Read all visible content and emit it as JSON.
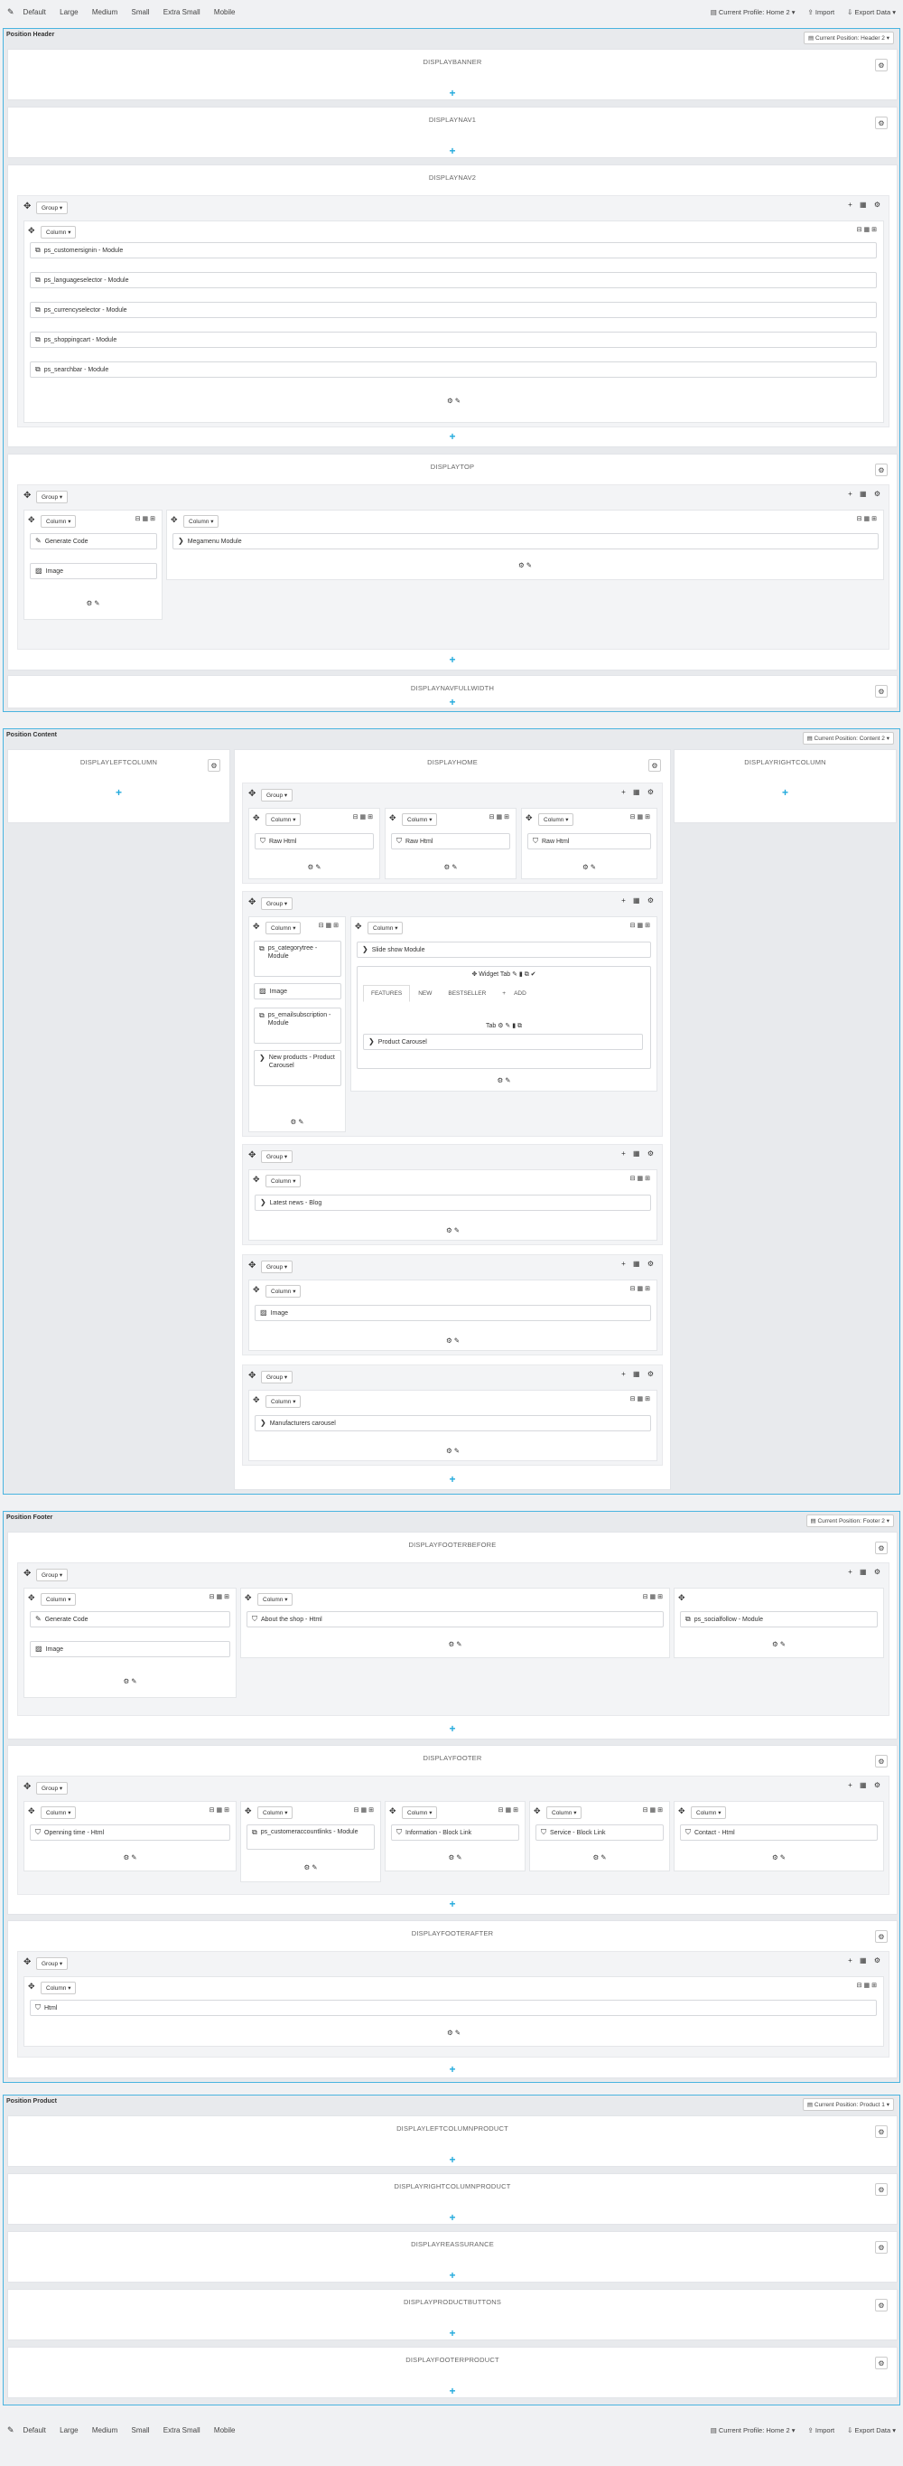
{
  "toolbar": {
    "sizes": [
      "Default",
      "Large",
      "Medium",
      "Small",
      "Extra Small",
      "Mobile"
    ],
    "profile": "Current Profile: Home 2",
    "import": "Import",
    "export": "Export Data"
  },
  "header": {
    "title": "Position Header",
    "position": "Current Position: Header 2",
    "hooks": [
      "DISPLAYBANNER",
      "DISPLAYNAV1",
      "DISPLAYNAV2",
      "DISPLAYTOP",
      "DISPLAYNAVFULLWIDTH"
    ],
    "nav2_modules": [
      "ps_customersignin - Module",
      "ps_languageselector - Module",
      "ps_currencyselector - Module",
      "ps_shoppingcart - Module",
      "ps_searchbar - Module"
    ],
    "top_left_modules": [
      "Generate Code",
      "Image"
    ],
    "top_right_module": "Megamenu Module"
  },
  "content": {
    "title": "Position Content",
    "position": "Current Position: Content 2",
    "left_hook": "DISPLAYLEFTCOLUMN",
    "home_hook": "DISPLAYHOME",
    "right_hook": "DISPLAYRIGHTCOLUMN",
    "raw_html": "Raw Html",
    "col2_modules": [
      "ps_categorytree - Module",
      "Image",
      "ps_emailsubscription - Module",
      "New products - Product Carousel"
    ],
    "slideshow": "Slide show Module",
    "widget_tab": "Widget Tab",
    "tabs": [
      "FEATURES",
      "NEW",
      "BESTSELLER",
      "ADD"
    ],
    "tab_label": "Tab",
    "product_carousel": "Product Carousel",
    "latest_news": "Latest news - Blog",
    "image": "Image",
    "manufacturers": "Manufacturers carousel"
  },
  "footer": {
    "title": "Position Footer",
    "position": "Current Position: Footer 2",
    "hooks": [
      "DISPLAYFOOTERBEFORE",
      "DISPLAYFOOTER",
      "DISPLAYFOOTERAFTER"
    ],
    "before_modules": [
      "Generate Code",
      "Image",
      "About the shop - Html",
      "ps_socialfollow - Module"
    ],
    "footer_modules": [
      "Openning time - Html",
      "ps_customeraccountlinks - Module",
      "Information - Block Link",
      "Service - Block Link",
      "Contact - Html"
    ],
    "after_module": "Html"
  },
  "product": {
    "title": "Position Product",
    "position": "Current Position: Product 1",
    "hooks": [
      "DISPLAYLEFTCOLUMNPRODUCT",
      "DISPLAYRIGHTCOLUMNPRODUCT",
      "DISPLAYREASSURANCE",
      "DISPLAYPRODUCTBUTTONS",
      "DISPLAYFOOTERPRODUCT"
    ]
  },
  "labels": {
    "group": "Group",
    "column": "Column"
  },
  "colors": {
    "accent": "#4ab4e0",
    "plus": "#22aadd"
  }
}
